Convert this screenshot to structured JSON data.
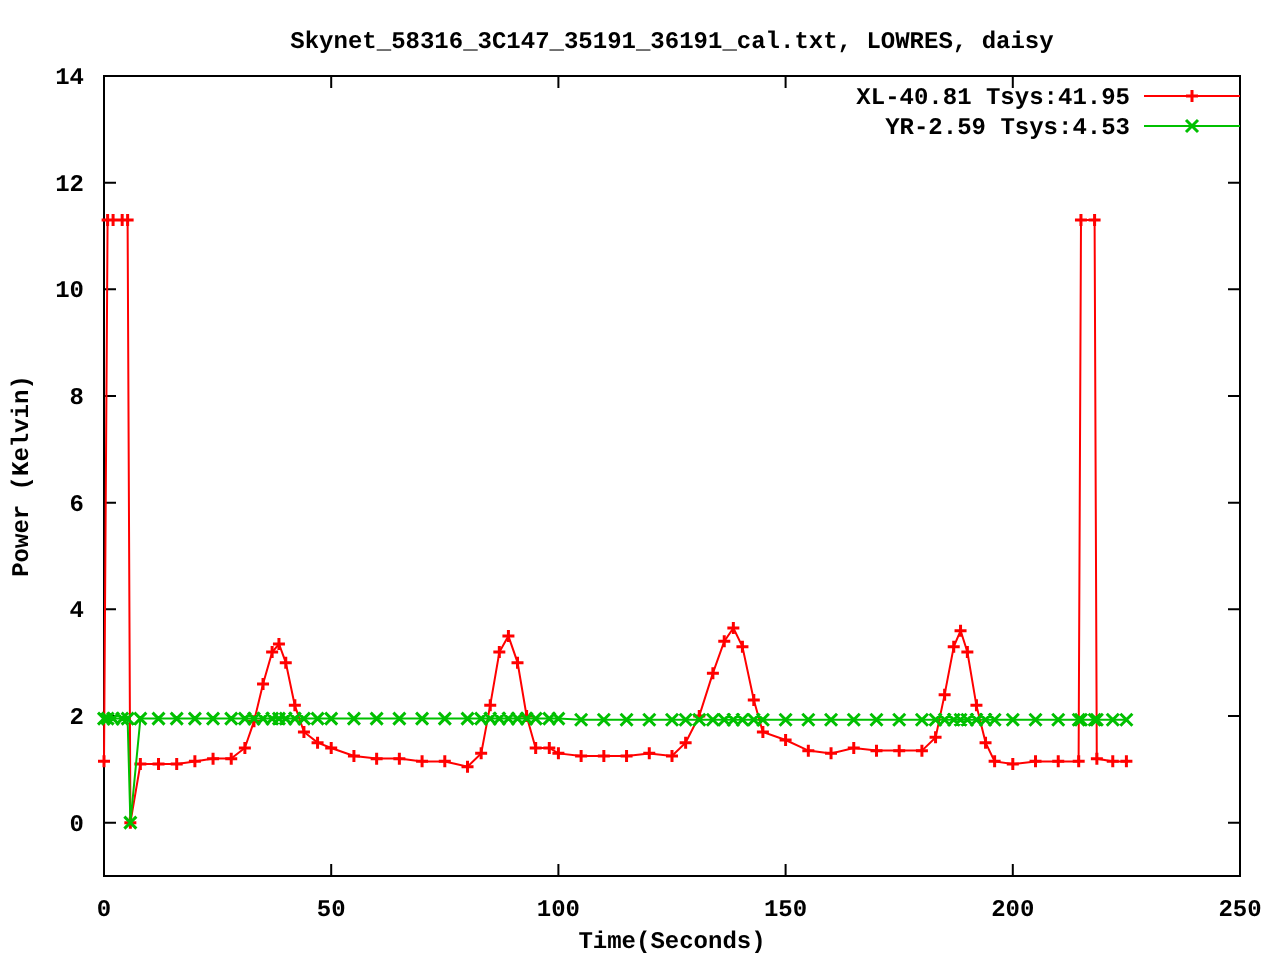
{
  "chart_data": {
    "type": "line",
    "title": "Skynet_58316_3C147_35191_36191_cal.txt, LOWRES, daisy",
    "xlabel": "Time(Seconds)",
    "ylabel": "Power (Kelvin)",
    "x": [
      0,
      0.8,
      2,
      4,
      5.2,
      5.8,
      8,
      12,
      16,
      20,
      24,
      28,
      31,
      33,
      35,
      37,
      38.5,
      40,
      42,
      44,
      47,
      50,
      55,
      60,
      65,
      70,
      75,
      80,
      83,
      85,
      87,
      89,
      91,
      93,
      95,
      98,
      100,
      105,
      110,
      115,
      120,
      125,
      128,
      131,
      134,
      136.5,
      138.5,
      140.5,
      143,
      145,
      150,
      155,
      160,
      165,
      170,
      175,
      180,
      183,
      185,
      187,
      188.5,
      190,
      192,
      194,
      196,
      200,
      205,
      210,
      214.5,
      215,
      218,
      218.5,
      222,
      225
    ],
    "series": [
      {
        "name": "XL-40.81 Tsys:41.95",
        "color": "#ff0000",
        "marker": "plus",
        "values": [
          1.15,
          11.3,
          11.3,
          11.3,
          11.3,
          0,
          1.1,
          1.1,
          1.1,
          1.15,
          1.2,
          1.2,
          1.4,
          1.9,
          2.6,
          3.2,
          3.35,
          3.0,
          2.2,
          1.7,
          1.5,
          1.4,
          1.25,
          1.2,
          1.2,
          1.15,
          1.15,
          1.05,
          1.3,
          2.2,
          3.2,
          3.5,
          3.0,
          2.0,
          1.4,
          1.4,
          1.3,
          1.25,
          1.25,
          1.25,
          1.3,
          1.25,
          1.5,
          2.0,
          2.8,
          3.4,
          3.65,
          3.3,
          2.3,
          1.7,
          1.55,
          1.35,
          1.3,
          1.4,
          1.35,
          1.35,
          1.35,
          1.6,
          2.4,
          3.3,
          3.6,
          3.2,
          2.2,
          1.5,
          1.15,
          1.1,
          1.15,
          1.15,
          1.15,
          11.3,
          11.3,
          1.2,
          1.15,
          1.15
        ]
      },
      {
        "name": "YR-2.59 Tsys:4.53",
        "color": "#00c000",
        "marker": "cross",
        "values": [
          1.95,
          1.95,
          1.95,
          1.95,
          1.95,
          0,
          1.95,
          1.95,
          1.95,
          1.95,
          1.95,
          1.95,
          1.95,
          1.95,
          1.95,
          1.95,
          1.95,
          1.95,
          1.95,
          1.95,
          1.95,
          1.95,
          1.95,
          1.95,
          1.95,
          1.95,
          1.95,
          1.95,
          1.95,
          1.95,
          1.95,
          1.95,
          1.95,
          1.95,
          1.95,
          1.95,
          1.95,
          1.93,
          1.93,
          1.93,
          1.93,
          1.93,
          1.93,
          1.93,
          1.93,
          1.93,
          1.93,
          1.93,
          1.93,
          1.93,
          1.93,
          1.93,
          1.93,
          1.93,
          1.93,
          1.93,
          1.93,
          1.93,
          1.93,
          1.93,
          1.93,
          1.93,
          1.93,
          1.93,
          1.93,
          1.93,
          1.93,
          1.93,
          1.93,
          1.93,
          1.93,
          1.93,
          1.93,
          1.93
        ]
      }
    ],
    "legend": true,
    "xlim": [
      0,
      250
    ],
    "ylim": [
      -1,
      14
    ],
    "xticks": [
      0,
      50,
      100,
      150,
      200,
      250
    ],
    "yticks": [
      0,
      2,
      4,
      6,
      8,
      10,
      12,
      14
    ]
  }
}
